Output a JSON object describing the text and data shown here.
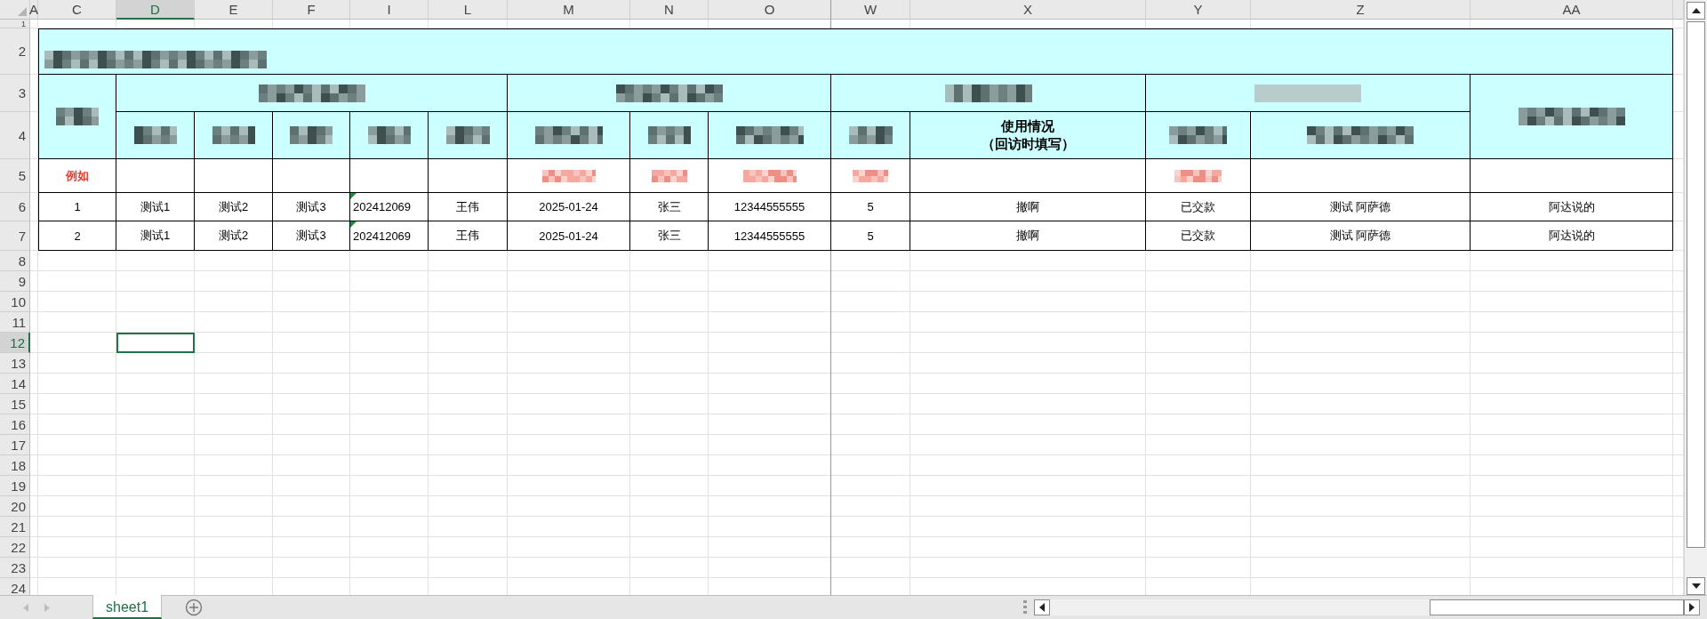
{
  "columns": [
    {
      "label": "A",
      "selected": false
    },
    {
      "label": "C",
      "selected": false
    },
    {
      "label": "D",
      "selected": true
    },
    {
      "label": "E",
      "selected": false
    },
    {
      "label": "F",
      "selected": false
    },
    {
      "label": "I",
      "selected": false
    },
    {
      "label": "L",
      "selected": false
    },
    {
      "label": "M",
      "selected": false
    },
    {
      "label": "N",
      "selected": false
    },
    {
      "label": "O",
      "selected": false
    },
    {
      "label": "W",
      "selected": false
    },
    {
      "label": "X",
      "selected": false
    },
    {
      "label": "Y",
      "selected": false
    },
    {
      "label": "Z",
      "selected": false
    },
    {
      "label": "AA",
      "selected": false
    }
  ],
  "rows": [
    {
      "label": "1",
      "selected": false
    },
    {
      "label": "2",
      "selected": false
    },
    {
      "label": "3",
      "selected": false
    },
    {
      "label": "4",
      "selected": false
    },
    {
      "label": "5",
      "selected": false
    },
    {
      "label": "6",
      "selected": false
    },
    {
      "label": "7",
      "selected": false
    },
    {
      "label": "8",
      "selected": false
    },
    {
      "label": "9",
      "selected": false
    },
    {
      "label": "10",
      "selected": false
    },
    {
      "label": "11",
      "selected": false
    },
    {
      "label": "12",
      "selected": true
    },
    {
      "label": "13",
      "selected": false
    },
    {
      "label": "14",
      "selected": false
    },
    {
      "label": "15",
      "selected": false
    },
    {
      "label": "16",
      "selected": false
    },
    {
      "label": "17",
      "selected": false
    },
    {
      "label": "18",
      "selected": false
    },
    {
      "label": "19",
      "selected": false
    },
    {
      "label": "20",
      "selected": false
    },
    {
      "label": "21",
      "selected": false
    },
    {
      "label": "22",
      "selected": false
    },
    {
      "label": "23",
      "selected": false
    },
    {
      "label": "24",
      "selected": false
    }
  ],
  "header_cells": [
    {
      "kind": "blurred"
    },
    {
      "kind": "blurred"
    },
    {
      "kind": "blurred"
    },
    {
      "kind": "blurred"
    },
    {
      "kind": "blurred"
    },
    {
      "kind": "blurred"
    },
    {
      "kind": "blurred"
    },
    {
      "kind": "blurred"
    },
    {
      "kind": "blurred"
    },
    {
      "kind": "blurred"
    },
    {
      "kind": "blurred"
    },
    {
      "kind": "blurred"
    },
    {
      "kind": "blurred"
    },
    {
      "kind": "blurred"
    },
    {
      "kind": "blurred"
    },
    {
      "kind": "blurred"
    },
    {
      "kind": "lines",
      "lines": [
        "使用情况",
        "（回访时填写）"
      ]
    },
    {
      "kind": "blurred"
    },
    {
      "kind": "blurred"
    }
  ],
  "example_row": [
    {
      "kind": "text",
      "text": "例如"
    },
    {
      "kind": "blank"
    },
    {
      "kind": "blank"
    },
    {
      "kind": "blank"
    },
    {
      "kind": "blank"
    },
    {
      "kind": "blank"
    },
    {
      "kind": "blurred"
    },
    {
      "kind": "blurred"
    },
    {
      "kind": "blurred"
    },
    {
      "kind": "blurred"
    },
    {
      "kind": "blank"
    },
    {
      "kind": "blurred"
    },
    {
      "kind": "blank"
    },
    {
      "kind": "blank"
    }
  ],
  "data_rows": [
    {
      "cells": [
        {
          "text": "1",
          "flag": false
        },
        {
          "text": "测试1",
          "flag": false
        },
        {
          "text": "测试2",
          "flag": false
        },
        {
          "text": "测试3",
          "flag": false
        },
        {
          "text": "202412069",
          "flag": true
        },
        {
          "text": "王伟",
          "flag": false
        },
        {
          "text": "2025-01-24",
          "flag": false
        },
        {
          "text": "张三",
          "flag": false
        },
        {
          "text": "12344555555",
          "flag": false
        },
        {
          "text": "5",
          "flag": false
        },
        {
          "text": "撤啊",
          "flag": false
        },
        {
          "text": "已交款",
          "flag": false
        },
        {
          "text": "测试 阿萨德",
          "flag": false
        },
        {
          "text": "阿达说的",
          "flag": false
        }
      ]
    },
    {
      "cells": [
        {
          "text": "2",
          "flag": false
        },
        {
          "text": "测试1",
          "flag": false
        },
        {
          "text": "测试2",
          "flag": false
        },
        {
          "text": "测试3",
          "flag": false
        },
        {
          "text": "202412069",
          "flag": true
        },
        {
          "text": "王伟",
          "flag": false
        },
        {
          "text": "2025-01-24",
          "flag": false
        },
        {
          "text": "张三",
          "flag": false
        },
        {
          "text": "12344555555",
          "flag": false
        },
        {
          "text": "5",
          "flag": false
        },
        {
          "text": "撤啊",
          "flag": false
        },
        {
          "text": "已交款",
          "flag": false
        },
        {
          "text": "测试 阿萨德",
          "flag": false
        },
        {
          "text": "阿达说的",
          "flag": false
        }
      ]
    }
  ],
  "sheet_tabs": [
    {
      "label": "sheet1",
      "selected": true
    }
  ]
}
